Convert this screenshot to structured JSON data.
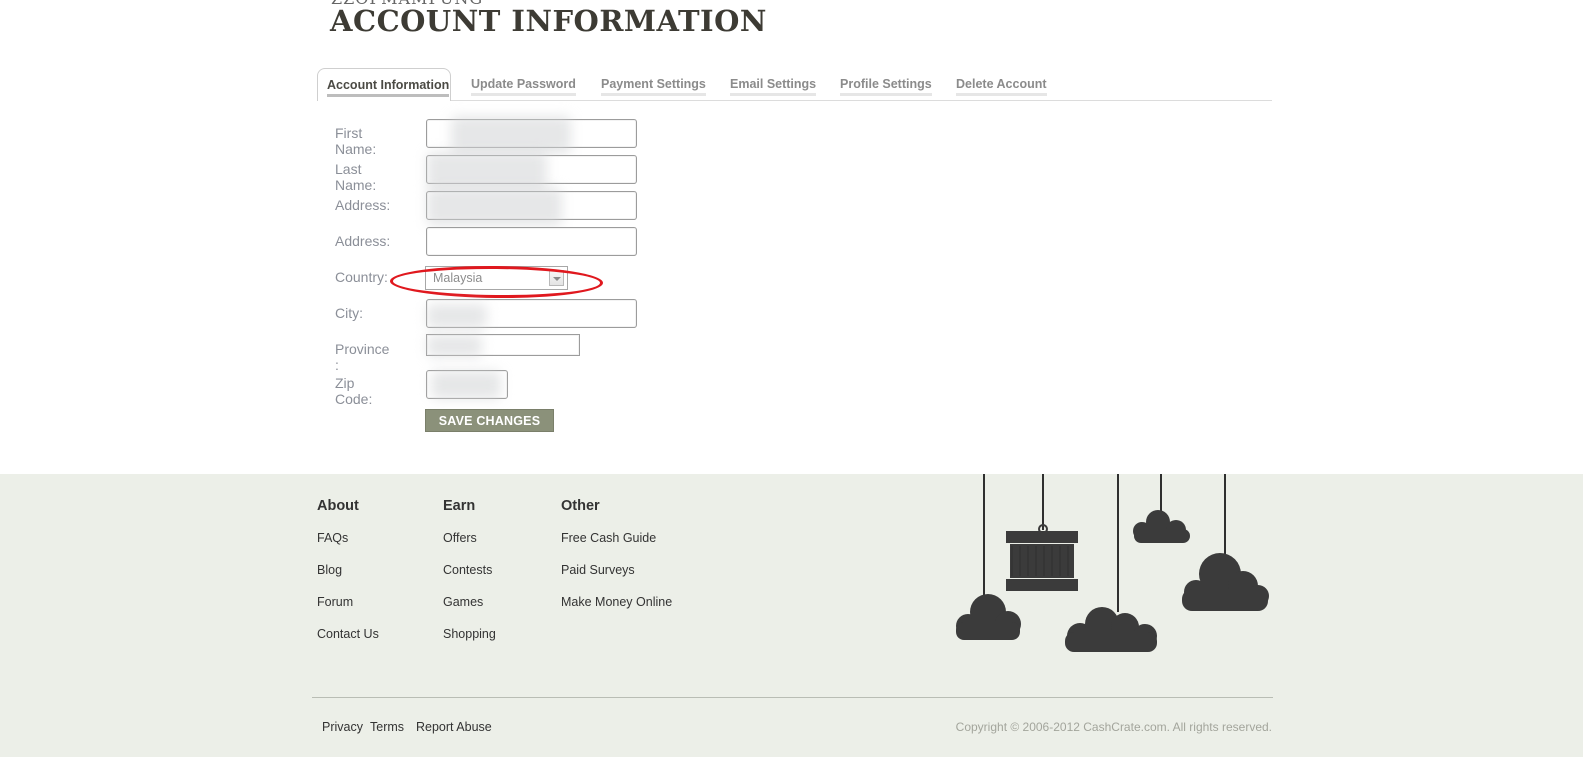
{
  "header": {
    "cut_text": "ZZOPMAMPUNG",
    "title": "ACCOUNT INFORMATION"
  },
  "tabs": [
    {
      "label": "Account Information",
      "active": true
    },
    {
      "label": "Update Password",
      "active": false
    },
    {
      "label": "Payment Settings",
      "active": false
    },
    {
      "label": "Email Settings",
      "active": false
    },
    {
      "label": "Profile Settings",
      "active": false
    },
    {
      "label": "Delete Account",
      "active": false
    }
  ],
  "form": {
    "labels": {
      "first_name": "First Name:",
      "last_name": "Last Name:",
      "address1": "Address:",
      "address2": "Address:",
      "country": "Country:",
      "city": "City:",
      "province": "Province :",
      "zip": "Zip Code:"
    },
    "country_value": "Malaysia",
    "save_label": "SAVE CHANGES"
  },
  "footer": {
    "about": {
      "heading": "About",
      "items": [
        "FAQs",
        "Blog",
        "Forum",
        "Contact Us"
      ]
    },
    "earn": {
      "heading": "Earn",
      "items": [
        "Offers",
        "Contests",
        "Games",
        "Shopping"
      ]
    },
    "other": {
      "heading": "Other",
      "items": [
        "Free Cash Guide",
        "Paid Surveys",
        "Make Money Online"
      ]
    },
    "bottom_links": [
      "Privacy",
      "Terms",
      "Report Abuse"
    ],
    "copyright": "Copyright © 2006-2012 CashCrate.com. All rights reserved."
  },
  "colors": {
    "accent_button": "#8b917a",
    "annotation_ellipse": "#e0181e",
    "footer_bg": "#ecefe8"
  }
}
